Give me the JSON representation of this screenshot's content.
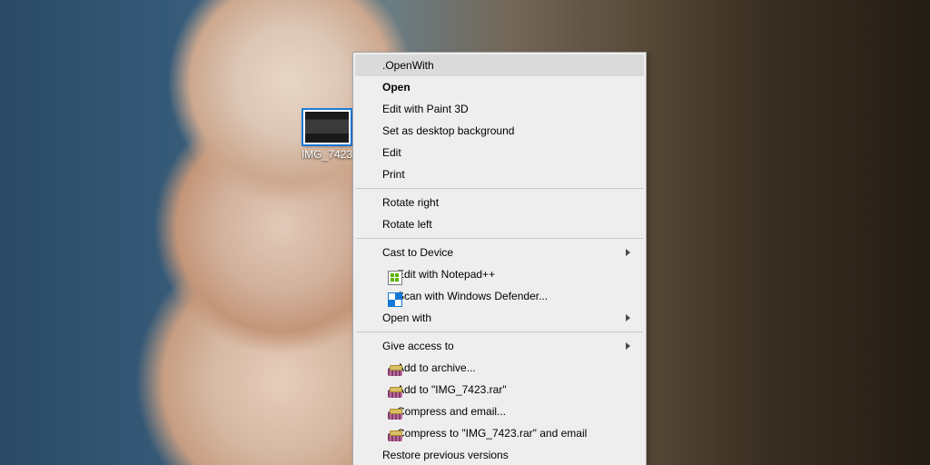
{
  "desktop": {
    "selected_file_label": "IMG_7423"
  },
  "context_menu": {
    "items": [
      {
        "label": ".OpenWith",
        "highlight": true
      },
      {
        "label": "Open",
        "bold": true
      },
      {
        "label": "Edit with Paint 3D"
      },
      {
        "label": "Set as desktop background"
      },
      {
        "label": "Edit"
      },
      {
        "label": "Print"
      },
      {
        "sep": true
      },
      {
        "label": "Rotate right"
      },
      {
        "label": "Rotate left"
      },
      {
        "sep": true
      },
      {
        "label": "Cast to Device",
        "submenu": true
      },
      {
        "label": "Edit with Notepad++",
        "icon": "notepadpp"
      },
      {
        "label": "Scan with Windows Defender...",
        "icon": "defender"
      },
      {
        "label": "Open with",
        "submenu": true
      },
      {
        "sep": true
      },
      {
        "label": "Give access to",
        "submenu": true
      },
      {
        "label": "Add to archive...",
        "icon": "winrar"
      },
      {
        "label": "Add to \"IMG_7423.rar\"",
        "icon": "winrar"
      },
      {
        "label": "Compress and email...",
        "icon": "winrar"
      },
      {
        "label": "Compress to \"IMG_7423.rar\" and email",
        "icon": "winrar"
      },
      {
        "label": "Restore previous versions"
      }
    ]
  }
}
